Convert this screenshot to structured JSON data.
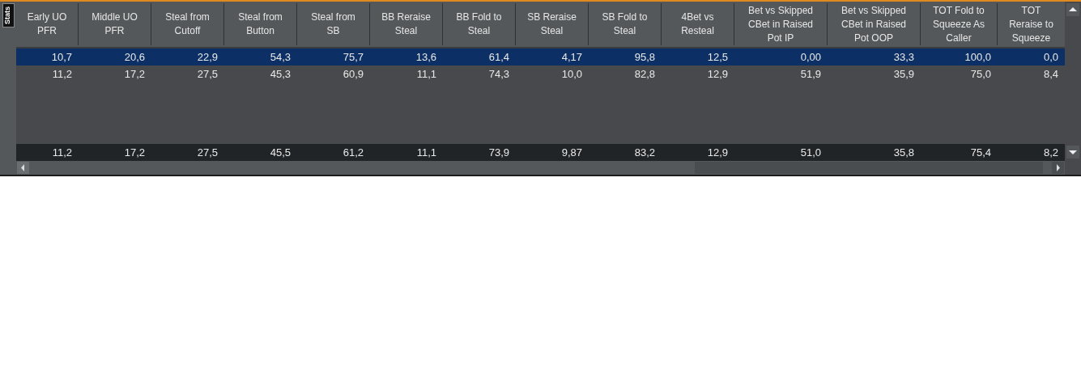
{
  "side_tab": {
    "label": "Stats"
  },
  "table": {
    "columns": [
      "Early UO PFR",
      "Middle UO PFR",
      "Steal from Cutoff",
      "Steal from Button",
      "Steal from SB",
      "BB Reraise Steal",
      "BB Fold to Steal",
      "SB Reraise Steal",
      "SB Fold to Steal",
      "4Bet vs Resteal",
      "Bet vs Skipped CBet in Raised Pot IP",
      "Bet vs Skipped CBet in Raised Pot OOP",
      "TOT Fold to Squeeze As Caller",
      "TOT Reraise to Squeeze"
    ],
    "rows": [
      {
        "kind": "data",
        "selected": true,
        "cells": [
          "10,7",
          "20,6",
          "22,9",
          "54,3",
          "75,7",
          "13,6",
          "61,4",
          "4,17",
          "95,8",
          "12,5",
          "0,00",
          "33,3",
          "100,0",
          "0,0"
        ]
      },
      {
        "kind": "data",
        "selected": false,
        "cells": [
          "11,2",
          "17,2",
          "27,5",
          "45,3",
          "60,9",
          "11,1",
          "74,3",
          "10,0",
          "82,8",
          "12,9",
          "51,9",
          "35,9",
          "75,0",
          "8,4"
        ]
      },
      {
        "kind": "summary",
        "cells": [
          "11,2",
          "17,2",
          "27,5",
          "45,5",
          "61,2",
          "11,1",
          "73,9",
          "9,87",
          "83,2",
          "12,9",
          "51,0",
          "35,8",
          "75,4",
          "8,2"
        ]
      }
    ]
  }
}
